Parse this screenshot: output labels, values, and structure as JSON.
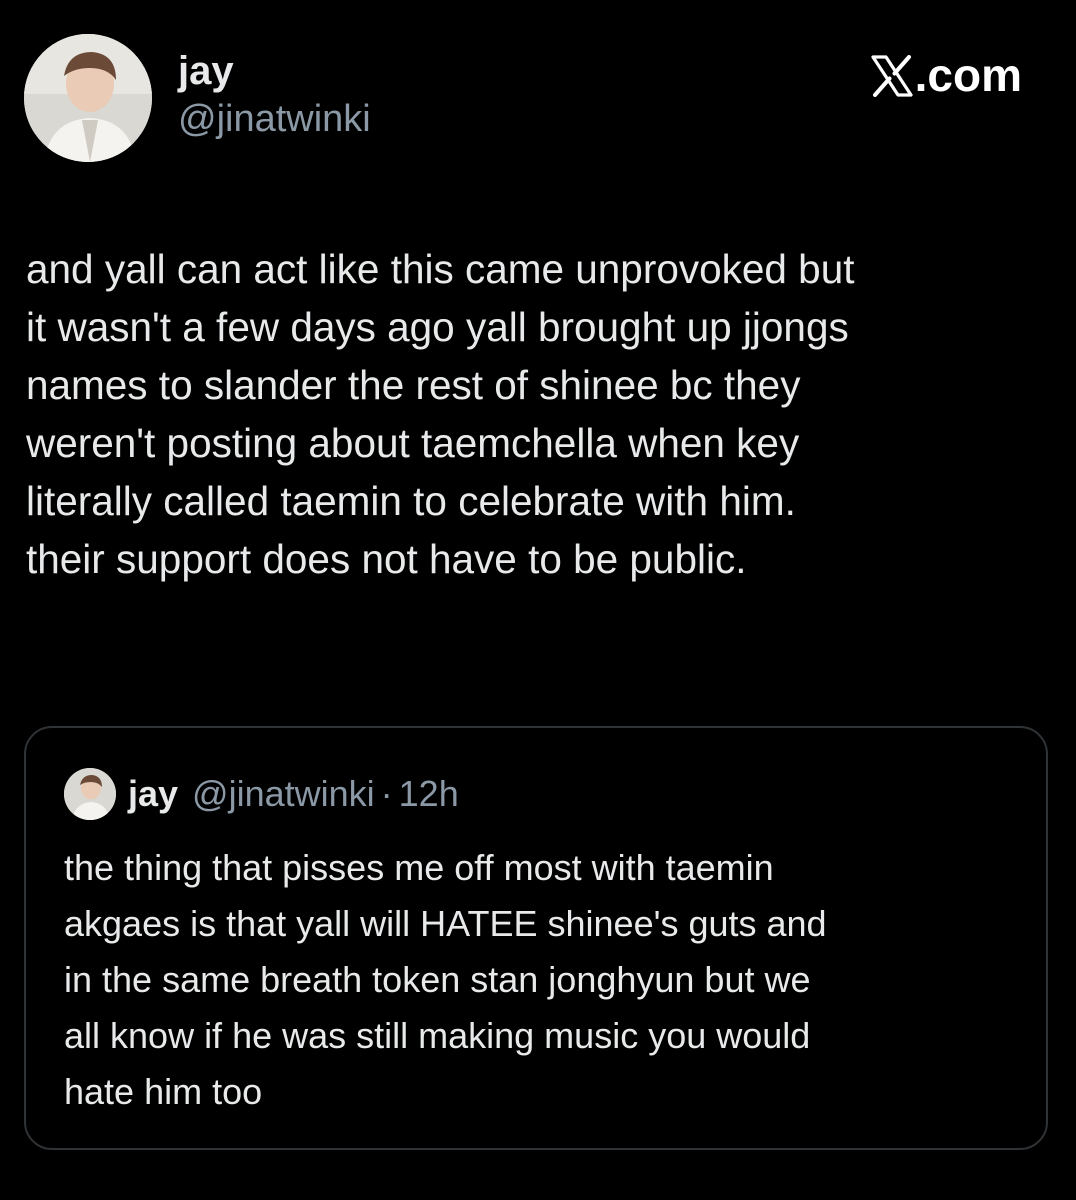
{
  "author": {
    "display_name": "jay",
    "handle": "@jinatwinki",
    "avatar_icon": "profile-photo"
  },
  "brand": {
    "label": ".com",
    "logo_icon": "x-logo-icon"
  },
  "tweet": {
    "text": "and yall can act like this came unprovoked but\nit wasn't a few days ago yall brought up jjongs\nnames to slander the rest of shinee bc they\nweren't posting about taemchella when key\nliterally called taemin to celebrate with him.\ntheir support does not have to be public."
  },
  "quoted_tweet": {
    "display_name": "jay",
    "handle": "@jinatwinki",
    "separator": "·",
    "time": "12h",
    "text": "the thing that pisses me off most with taemin\nakgaes is that yall will HATEE shinee's guts and\nin the same breath token stan jonghyun but we\nall know if he was still making music you would\nhate him too"
  },
  "colors": {
    "background": "#000000",
    "primary_text": "#e7e9ea",
    "secondary_text": "#8b98a5",
    "border": "#2f3336"
  }
}
